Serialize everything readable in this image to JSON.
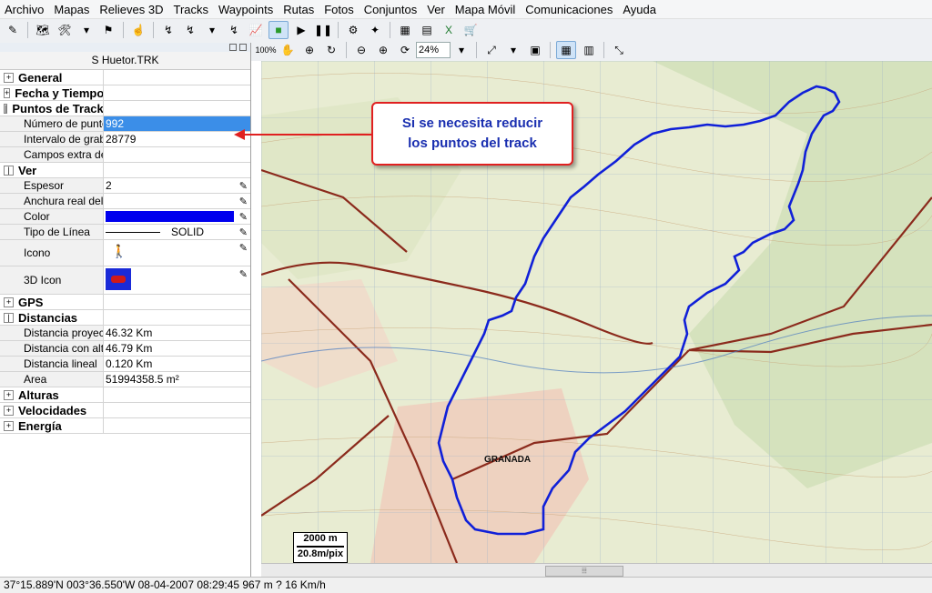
{
  "menu": [
    "Archivo",
    "Mapas",
    "Relieves 3D",
    "Tracks",
    "Waypoints",
    "Rutas",
    "Fotos",
    "Conjuntos",
    "Ver",
    "Mapa Móvil",
    "Comunicaciones",
    "Ayuda"
  ],
  "toolbar": {
    "row2_percent": "100%",
    "zoom_value": "24%"
  },
  "panel": {
    "title": "S Huetor.TRK",
    "rows": [
      {
        "type": "cat",
        "sign": "+",
        "label": "General",
        "value": ""
      },
      {
        "type": "cat",
        "sign": "+",
        "label": "Fecha y Tiempo",
        "value": ""
      },
      {
        "type": "cat",
        "sign": "-",
        "label": "Puntos de Track",
        "value": ""
      },
      {
        "type": "sub",
        "label": "Número de puntos",
        "value": "992",
        "selected": true
      },
      {
        "type": "sub",
        "label": "Intervalo de grabación",
        "value": "28779"
      },
      {
        "type": "sub",
        "label": "Campos extra de",
        "value": ""
      },
      {
        "type": "cat",
        "sign": "-",
        "label": "Ver",
        "value": ""
      },
      {
        "type": "sub",
        "label": "Espesor",
        "value": "2",
        "pencil": true
      },
      {
        "type": "sub",
        "label": "Anchura real del",
        "value": "",
        "pencil": true
      },
      {
        "type": "sub",
        "label": "Color",
        "value": "",
        "color": "#0000ee",
        "pencil": true
      },
      {
        "type": "sub",
        "label": "Tipo de Línea",
        "value": "SOLID",
        "pencil": true,
        "line": true
      },
      {
        "type": "sub",
        "label": "Icono",
        "value": "",
        "pencil": true,
        "tall": 28,
        "icon": "person-icon"
      },
      {
        "type": "sub",
        "label": "3D Icon",
        "value": "",
        "pencil": true,
        "tall": 30,
        "icon": "car-3d-icon"
      },
      {
        "type": "cat",
        "sign": "+",
        "label": "GPS",
        "value": ""
      },
      {
        "type": "cat",
        "sign": "-",
        "label": "Distancias",
        "value": ""
      },
      {
        "type": "sub",
        "label": "Distancia proyectada",
        "value": "46.32 Km"
      },
      {
        "type": "sub",
        "label": "Distancia con altura",
        "value": "46.79 Km"
      },
      {
        "type": "sub",
        "label": "Distancia lineal",
        "value": "0.120 Km"
      },
      {
        "type": "sub",
        "label": "Area",
        "value": "51994358.5 m²"
      },
      {
        "type": "cat",
        "sign": "+",
        "label": "Alturas",
        "value": ""
      },
      {
        "type": "cat",
        "sign": "+",
        "label": "Velocidades",
        "value": ""
      },
      {
        "type": "cat",
        "sign": "+",
        "label": "Energía",
        "value": ""
      }
    ]
  },
  "callout": {
    "line1": "Si se necesita reducir",
    "line2": "los puntos del track"
  },
  "map": {
    "city_label": "GRANADA",
    "scale_distance": "2000 m",
    "scale_resolution": "20.8m/pix",
    "track_color": "#1020d8"
  },
  "status": "37°15.889'N 003°36.550'W  08-04-2007  08:29:45  967 m  ?  16 Km/h"
}
